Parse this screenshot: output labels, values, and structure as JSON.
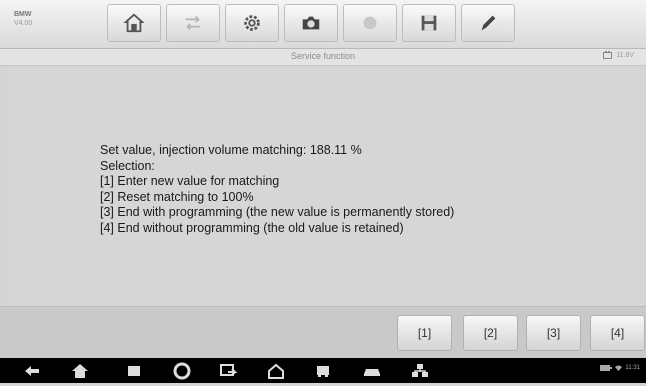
{
  "header": {
    "brand": "BMW",
    "brand_sub": "V4.00",
    "toolbar": [
      {
        "icon": "home-icon"
      },
      {
        "icon": "vehicle-swap-icon"
      },
      {
        "icon": "gear-icon"
      },
      {
        "icon": "camera-icon"
      },
      {
        "icon": "record-icon"
      },
      {
        "icon": "save-icon"
      },
      {
        "icon": "pen-icon"
      }
    ]
  },
  "subheader": {
    "title": "Service function",
    "status": "11.8V"
  },
  "message": {
    "lines": [
      "Set value, injection volume matching: 188.11 %",
      "Selection:",
      "[1] Enter new value for matching",
      "[2] Reset matching to 100%",
      "[3] End with programming (the new value is permanently stored)",
      "[4] End without programming (the old value is retained)"
    ]
  },
  "buttons": [
    "[1]",
    "[2]",
    "[3]",
    "[4]"
  ],
  "navbar": {
    "icons": [
      "back-icon",
      "android-home-icon",
      "recent-apps-icon",
      "browser-icon",
      "shortcut-icon",
      "maxisys-home-icon",
      "vehicle-icon",
      "car-icon",
      "network-icon"
    ],
    "status": "11:31"
  }
}
